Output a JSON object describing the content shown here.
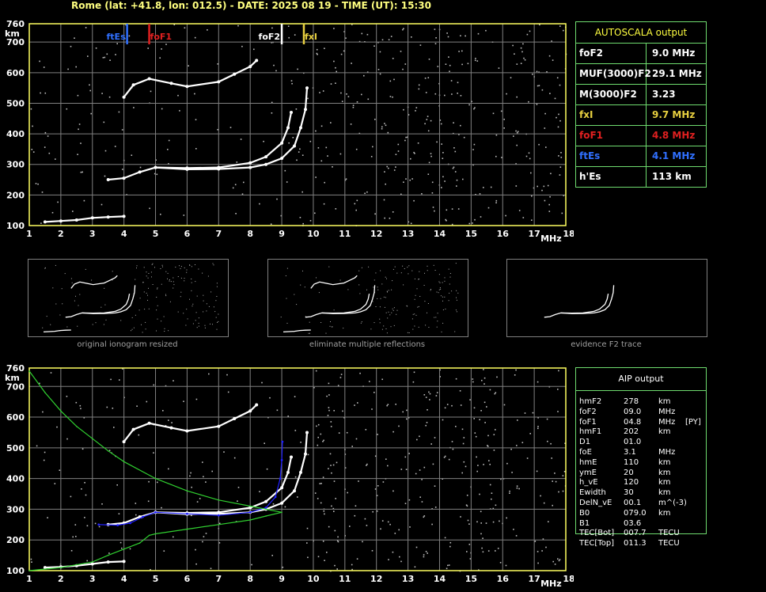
{
  "header": "Rome (lat: +41.8, lon: 012.5) - DATE: 2025 08 19 - TIME (UT): 15:30",
  "autoscala": {
    "title": "AUTOSCALA output",
    "rows": [
      {
        "label": "foF2",
        "value": "9.0 MHz",
        "color": "#ffffff"
      },
      {
        "label": "MUF(3000)F2",
        "value": "29.1 MHz",
        "color": "#ffffff"
      },
      {
        "label": "M(3000)F2",
        "value": "3.23",
        "color": "#ffffff"
      },
      {
        "label": "fxI",
        "value": "9.7 MHz",
        "color": "#e8d040"
      },
      {
        "label": "foF1",
        "value": "4.8 MHz",
        "color": "#e02020"
      },
      {
        "label": "ftEs",
        "value": "4.1 MHz",
        "color": "#3070ff"
      },
      {
        "label": "h'Es",
        "value": "113    km",
        "color": "#ffffff"
      }
    ]
  },
  "aip": {
    "title": "AIP output",
    "rows": [
      {
        "name": "hmF2",
        "value": "278",
        "unit": "km",
        "extra": ""
      },
      {
        "name": "foF2",
        "value": "09.0",
        "unit": "MHz",
        "extra": ""
      },
      {
        "name": "foF1",
        "value": "04.8",
        "unit": "MHz",
        "extra": "[PY]"
      },
      {
        "name": "hmF1",
        "value": "202",
        "unit": "km",
        "extra": ""
      },
      {
        "name": "D1",
        "value": "01.0",
        "unit": "",
        "extra": ""
      },
      {
        "name": "foE",
        "value": "3.1",
        "unit": "MHz",
        "extra": ""
      },
      {
        "name": "hmE",
        "value": "110",
        "unit": "km",
        "extra": ""
      },
      {
        "name": "ymE",
        "value": "20",
        "unit": "km",
        "extra": ""
      },
      {
        "name": "h_vE",
        "value": "120",
        "unit": "km",
        "extra": ""
      },
      {
        "name": "Ewidth",
        "value": "30",
        "unit": "km",
        "extra": ""
      },
      {
        "name": "DelN_vE",
        "value": "00.1",
        "unit": "m^(-3)",
        "extra": ""
      },
      {
        "name": "B0",
        "value": "079.0",
        "unit": "km",
        "extra": ""
      },
      {
        "name": "B1",
        "value": "03.6",
        "unit": "",
        "extra": ""
      },
      {
        "name": "TEC[Bot]",
        "value": "007.7",
        "unit": "TECU",
        "extra": ""
      },
      {
        "name": "TEC[Top]",
        "value": "011.3",
        "unit": "TECU",
        "extra": ""
      }
    ]
  },
  "captions": [
    "original ionogram resized",
    "eliminate multiple reflections",
    "evidence F2 trace"
  ],
  "markers": [
    {
      "label": "ftEs",
      "freq": 4.1,
      "color": "#3070ff"
    },
    {
      "label": "foF1",
      "freq": 4.8,
      "color": "#e02020"
    },
    {
      "label": "foF2",
      "freq": 9.0,
      "color": "#ffffff"
    },
    {
      "label": "fxI",
      "freq": 9.7,
      "color": "#e8d040"
    }
  ],
  "colors": {
    "grid": "#808080",
    "frame": "#ffff60",
    "profile": "#30d030",
    "fit": "#2020ff",
    "trace": "#ffffff"
  },
  "chart_data": [
    {
      "type": "scatter",
      "title": "",
      "xlabel": "MHz",
      "ylabel": "km",
      "xlim": [
        1,
        18
      ],
      "ylim": [
        100,
        760
      ],
      "x_ticks": [
        1,
        2,
        3,
        4,
        5,
        6,
        7,
        8,
        9,
        10,
        11,
        12,
        13,
        14,
        15,
        16,
        17,
        18
      ],
      "y_ticks": [
        100,
        200,
        300,
        400,
        500,
        600,
        700,
        760
      ],
      "grid": true,
      "series": [
        {
          "name": "",
          "points": [
            [
              1.5,
              112
            ],
            [
              2.0,
              115
            ],
            [
              2.5,
              118
            ],
            [
              3.0,
              125
            ],
            [
              3.5,
              128
            ],
            [
              4.0,
              130
            ]
          ]
        },
        {
          "name": "",
          "points": [
            [
              3.5,
              250
            ],
            [
              4.0,
              255
            ],
            [
              4.5,
              275
            ],
            [
              5.0,
              290
            ],
            [
              6.0,
              288
            ],
            [
              7.0,
              290
            ],
            [
              8.0,
              305
            ],
            [
              8.5,
              325
            ],
            [
              9.0,
              370
            ],
            [
              9.2,
              420
            ],
            [
              9.3,
              470
            ]
          ]
        },
        {
          "name": "",
          "points": [
            [
              5.0,
              290
            ],
            [
              6.0,
              284
            ],
            [
              7.0,
              285
            ],
            [
              8.0,
              290
            ],
            [
              8.5,
              300
            ],
            [
              9.0,
              320
            ],
            [
              9.4,
              360
            ],
            [
              9.6,
              420
            ],
            [
              9.75,
              480
            ],
            [
              9.8,
              550
            ]
          ]
        },
        {
          "name": "",
          "points": [
            [
              4.0,
              520
            ],
            [
              4.3,
              560
            ],
            [
              4.8,
              580
            ],
            [
              5.5,
              565
            ],
            [
              6.0,
              555
            ],
            [
              7.0,
              570
            ],
            [
              7.5,
              595
            ],
            [
              8.0,
              620
            ],
            [
              8.2,
              640
            ]
          ]
        }
      ]
    },
    {
      "type": "scatter",
      "title": "",
      "xlabel": "MHz",
      "ylabel": "km",
      "xlim": [
        1,
        18
      ],
      "ylim": [
        100,
        760
      ],
      "x_ticks": [
        1,
        2,
        3,
        4,
        5,
        6,
        7,
        8,
        9,
        10,
        11,
        12,
        13,
        14,
        15,
        16,
        17,
        18
      ],
      "y_ticks": [
        100,
        200,
        300,
        400,
        500,
        600,
        700,
        760
      ],
      "grid": true,
      "series": [
        {
          "name": "",
          "points": [
            [
              1.5,
              110
            ],
            [
              2.0,
              112
            ],
            [
              2.5,
              116
            ],
            [
              3.0,
              122
            ],
            [
              3.5,
              128
            ],
            [
              4.0,
              130
            ]
          ]
        },
        {
          "name": "",
          "points": [
            [
              3.5,
              250
            ],
            [
              4.0,
              255
            ],
            [
              4.5,
              275
            ],
            [
              5.0,
              290
            ],
            [
              6.0,
              288
            ],
            [
              7.0,
              290
            ],
            [
              8.0,
              305
            ],
            [
              8.5,
              325
            ],
            [
              9.0,
              370
            ],
            [
              9.2,
              420
            ],
            [
              9.3,
              470
            ]
          ]
        },
        {
          "name": "",
          "points": [
            [
              5.0,
              290
            ],
            [
              6.0,
              284
            ],
            [
              7.0,
              285
            ],
            [
              8.0,
              290
            ],
            [
              8.5,
              300
            ],
            [
              9.0,
              320
            ],
            [
              9.4,
              360
            ],
            [
              9.6,
              420
            ],
            [
              9.75,
              480
            ],
            [
              9.8,
              550
            ]
          ]
        },
        {
          "name": "",
          "points": [
            [
              4.0,
              520
            ],
            [
              4.3,
              560
            ],
            [
              4.8,
              580
            ],
            [
              5.5,
              565
            ],
            [
              6.0,
              555
            ],
            [
              7.0,
              570
            ],
            [
              7.5,
              595
            ],
            [
              8.0,
              620
            ],
            [
              8.2,
              640
            ]
          ]
        },
        {
          "name": "",
          "points": [
            [
              3.2,
              250
            ],
            [
              3.8,
              248
            ],
            [
              4.2,
              255
            ],
            [
              4.6,
              275
            ],
            [
              5.0,
              290
            ],
            [
              6.0,
              285
            ],
            [
              7.0,
              280
            ],
            [
              8.0,
              290
            ],
            [
              8.5,
              305
            ],
            [
              8.8,
              340
            ],
            [
              8.95,
              400
            ],
            [
              9.0,
              460
            ],
            [
              9.02,
              520
            ]
          ]
        },
        {
          "name": "",
          "points": [
            [
              1.0,
              750
            ],
            [
              1.5,
              680
            ],
            [
              2.0,
              620
            ],
            [
              2.5,
              570
            ],
            [
              3.0,
              530
            ],
            [
              3.5,
              490
            ],
            [
              4.0,
              455
            ],
            [
              5.0,
              400
            ],
            [
              6.0,
              360
            ],
            [
              7.0,
              330
            ],
            [
              8.0,
              310
            ],
            [
              8.5,
              300
            ],
            [
              9.0,
              290
            ],
            [
              8.5,
              278
            ],
            [
              8.0,
              265
            ],
            [
              7.0,
              250
            ],
            [
              6.0,
              235
            ],
            [
              5.0,
              220
            ],
            [
              4.8,
              215
            ],
            [
              4.5,
              190
            ],
            [
              4.0,
              170
            ],
            [
              3.5,
              150
            ],
            [
              3.0,
              128
            ],
            [
              2.0,
              110
            ],
            [
              1.0,
              100
            ]
          ]
        }
      ]
    }
  ]
}
